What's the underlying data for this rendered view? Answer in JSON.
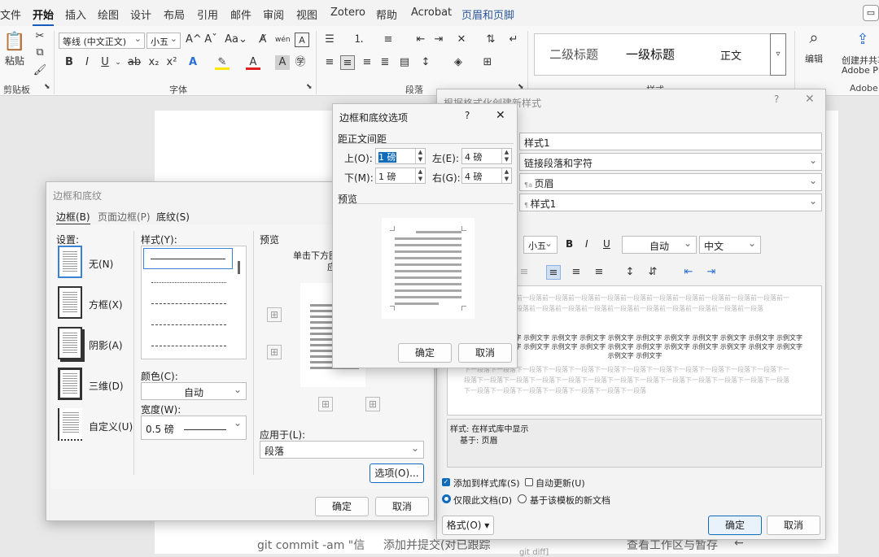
{
  "ribbon_tabs": [
    "文件",
    "开始",
    "插入",
    "绘图",
    "设计",
    "布局",
    "引用",
    "邮件",
    "审阅",
    "视图",
    "Zotero",
    "帮助",
    "Acrobat",
    "页眉和页脚"
  ],
  "ribbon": {
    "paste": "粘贴",
    "clipboard": "剪贴板",
    "font_name": "等线 (中文正文)",
    "font_size": "小五",
    "font_group": "字体",
    "para_group": "段落",
    "style1": "二级标题",
    "style2": "一级标题",
    "style3": "正文",
    "styles_group": "样式",
    "edit": "编辑",
    "create_share": "创建并共享",
    "adobe_pdf": "Adobe PDF",
    "adobe": "Adobe"
  },
  "doc_footer": {
    "cmd": "git commit -am \"信",
    "desc": "添加并提交(对已跟踪",
    "diff": "git diff]",
    "right": "查看工作区与暂存",
    "arrow": "←"
  },
  "border_dialog": {
    "title": "边框和底纹",
    "tabs": [
      "边框(B)",
      "页面边框(P)",
      "底纹(S)"
    ],
    "settings_label": "设置:",
    "settings": [
      "无(N)",
      "方框(X)",
      "阴影(A)",
      "三维(D)",
      "自定义(U)"
    ],
    "style_label": "样式(Y):",
    "color_label": "颜色(C):",
    "color_value": "自动",
    "width_label": "宽度(W):",
    "width_value": "0.5 磅",
    "preview_label": "预览",
    "preview_hint": "单击下方图",
    "preview_hint2": "应",
    "apply_label": "应用于(L):",
    "apply_value": "段落",
    "options_btn": "选项(O)...",
    "ok": "确定",
    "cancel": "取消"
  },
  "options_dialog": {
    "title": "边框和底纹选项",
    "help": "?",
    "close": "✕",
    "section": "距正文间距",
    "top_label": "上(O):",
    "top_value": "1 磅",
    "bottom_label": "下(M):",
    "bottom_value": "1 磅",
    "left_label": "左(E):",
    "left_value": "4 磅",
    "right_label": "右(G):",
    "right_value": "4 磅",
    "preview_label": "预览",
    "ok": "确定",
    "cancel": "取消"
  },
  "newstyle_dialog": {
    "title": "根据格式化创建新样式",
    "help": "?",
    "close": "✕",
    "name": "样式1",
    "type": "链接段落和字符",
    "based_on": "页眉",
    "next": "样式1",
    "font_size": "小五",
    "bold": "B",
    "italic": "I",
    "underline": "U",
    "color": "自动",
    "script": "中文",
    "prev_para": "前一段落前一段落前一段落前一段落前一段落前一段落前一段落前一段落前一段落前一段落前一段落前一段落前一段落前一段落前一段落前一段落前一段落前一段落前一段落前一段落前一段落前一段落前一段落前一段落",
    "sample": "示例文字 示例文字 示例文字 示例文字 示例文字 示例文字 示例文字 示例文字 示例文字 示例文字 示例文字 示例文字 示例文字 示例文字 示例文字 示例文字 示例文字 示例文字 示例文字 示例文字 示例文字 示例文字 示例文字 示例文字 示例文字 示例文字",
    "next_para": "下一段落下一段落下一段落下一段落下一段落下一段落下一段落下一段落下一段落下一段落下一段落下一段落下一段落下一段落下一段落下一段落下一段落下一段落下一段落下一段落下一段落下一段落下一段落下一段落下一段落下一段落下一段落下一段落下一段落下一段落下一段落下一段落",
    "desc1": "样式: 在样式库中显示",
    "desc2": "基于: 页眉",
    "add_gallery": "添加到样式库(S)",
    "auto_update": "自动更新(U)",
    "only_doc": "仅限此文档(D)",
    "new_docs": "基于该模板的新文档",
    "format_btn": "格式(O)",
    "ok": "确定",
    "cancel": "取消"
  }
}
